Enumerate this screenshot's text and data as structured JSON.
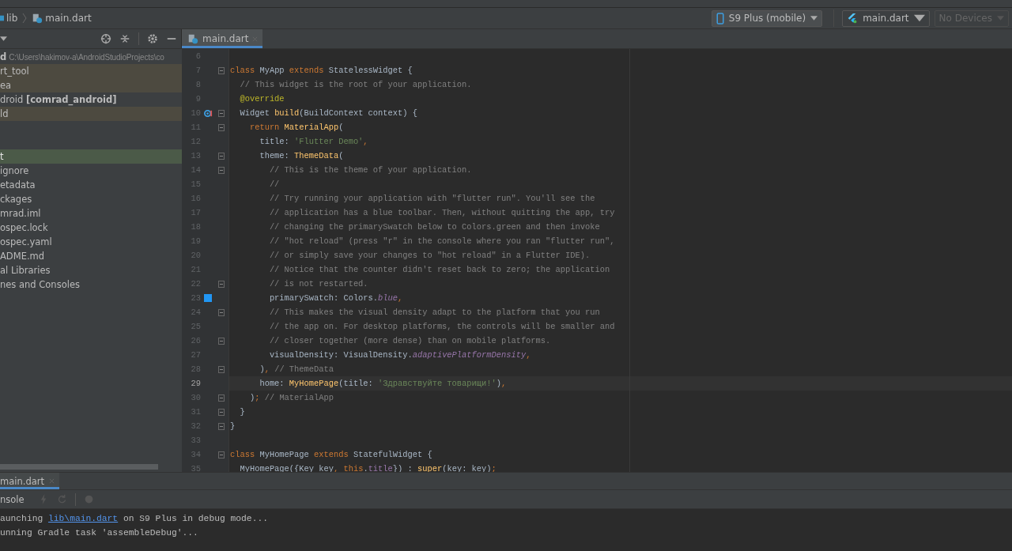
{
  "breadcrumbs": [
    {
      "label": "lib",
      "kind": "folder"
    },
    {
      "label": "main.dart",
      "kind": "dart"
    }
  ],
  "run_controls": [
    {
      "label": "S9 Plus (mobile)",
      "kind": "device",
      "disabled": false
    },
    {
      "label": "main.dart",
      "kind": "config",
      "disabled": false
    },
    {
      "label": "No Devices",
      "kind": "plain",
      "disabled": true
    }
  ],
  "editor_tabs": [
    {
      "label": "main.dart",
      "selected": true
    }
  ],
  "project_tree": [
    {
      "label": "d",
      "path": "C:\\Users\\hakimov-a\\AndroidStudioProjects\\co",
      "kind": "root",
      "selected": false
    },
    {
      "label": "rt_tool",
      "kind": "excluded",
      "selected": false
    },
    {
      "label": "ea",
      "kind": "excluded",
      "selected": false
    },
    {
      "label": "droid **[comrad_android]**",
      "kind": "plain",
      "selected": false
    },
    {
      "label": "ld",
      "kind": "excluded",
      "selected": false
    },
    {
      "kind": "plain",
      "selected": false
    },
    {
      "kind": "plain",
      "selected": false
    },
    {
      "label": "t",
      "kind": "plain",
      "selected": true
    },
    {
      "label": "ignore",
      "kind": "plain",
      "selected": false
    },
    {
      "label": "etadata",
      "kind": "plain",
      "selected": false
    },
    {
      "label": "ckages",
      "kind": "plain",
      "selected": false
    },
    {
      "label": "mrad.iml",
      "kind": "plain",
      "selected": false
    },
    {
      "label": "ospec.lock",
      "kind": "plain",
      "selected": false
    },
    {
      "label": "ospec.yaml",
      "kind": "plain",
      "selected": false
    },
    {
      "label": "ADME.md",
      "kind": "plain",
      "selected": false
    },
    {
      "label": "al Libraries",
      "kind": "plain",
      "selected": false
    },
    {
      "label": "nes and Consoles",
      "kind": "plain",
      "selected": false
    }
  ],
  "code_lines": [
    {
      "number": "6"
    },
    {
      "number": "7",
      "fold": true,
      "tokens": [
        {
          "kind": "keyword",
          "text": "class "
        },
        {
          "kind": "plain",
          "text": "MyApp "
        },
        {
          "kind": "keyword",
          "text": "extends "
        },
        {
          "kind": "plain",
          "text": "StatelessWidget {"
        }
      ]
    },
    {
      "number": "8",
      "tokens": [
        {
          "kind": "comment",
          "text": "  // This widget is the root of your application."
        }
      ]
    },
    {
      "number": "9",
      "tokens": [
        {
          "kind": "annotation",
          "text": "  @override"
        }
      ]
    },
    {
      "number": "10",
      "fold": true,
      "overrides": true,
      "tokens": [
        {
          "kind": "plain",
          "text": "  Widget "
        },
        {
          "kind": "function",
          "text": "build"
        },
        {
          "kind": "plain",
          "text": "(BuildContext context) {"
        }
      ]
    },
    {
      "number": "11",
      "fold": true,
      "tokens": [
        {
          "kind": "keyword",
          "text": "    return "
        },
        {
          "kind": "function",
          "text": "MaterialApp"
        },
        {
          "kind": "plain",
          "text": "("
        }
      ]
    },
    {
      "number": "12",
      "tokens": [
        {
          "kind": "plain",
          "text": "      title: "
        },
        {
          "kind": "string",
          "text": "'Flutter Demo'"
        },
        {
          "kind": "keyword",
          "text": ","
        }
      ]
    },
    {
      "number": "13",
      "fold": true,
      "tokens": [
        {
          "kind": "plain",
          "text": "      theme: "
        },
        {
          "kind": "function",
          "text": "ThemeData"
        },
        {
          "kind": "plain",
          "text": "("
        }
      ]
    },
    {
      "number": "14",
      "fold": true,
      "tokens": [
        {
          "kind": "comment",
          "text": "        // This is the theme of your application."
        }
      ]
    },
    {
      "number": "15",
      "tokens": [
        {
          "kind": "comment",
          "text": "        //"
        }
      ]
    },
    {
      "number": "16",
      "tokens": [
        {
          "kind": "comment",
          "text": "        // Try running your application with \"flutter run\". You'll see the"
        }
      ]
    },
    {
      "number": "17",
      "tokens": [
        {
          "kind": "comment",
          "text": "        // application has a blue toolbar. Then, without quitting the app, try"
        }
      ]
    },
    {
      "number": "18",
      "tokens": [
        {
          "kind": "comment",
          "text": "        // changing the primarySwatch below to Colors.green and then invoke"
        }
      ]
    },
    {
      "number": "19",
      "tokens": [
        {
          "kind": "comment",
          "text": "        // \"hot reload\" (press \"r\" in the console where you ran \"flutter run\","
        }
      ]
    },
    {
      "number": "20",
      "tokens": [
        {
          "kind": "comment",
          "text": "        // or simply save your changes to \"hot reload\" in a Flutter IDE)."
        }
      ]
    },
    {
      "number": "21",
      "tokens": [
        {
          "kind": "comment",
          "text": "        // Notice that the counter didn't reset back to zero; the application"
        }
      ]
    },
    {
      "number": "22",
      "fold": true,
      "tokens": [
        {
          "kind": "comment",
          "text": "        // is not restarted."
        }
      ]
    },
    {
      "number": "23",
      "color": "#2196f3",
      "tokens": [
        {
          "kind": "plain",
          "text": "        primarySwatch: Colors."
        },
        {
          "kind": "static",
          "text": "blue"
        },
        {
          "kind": "keyword",
          "text": ","
        }
      ]
    },
    {
      "number": "24",
      "fold": true,
      "tokens": [
        {
          "kind": "comment",
          "text": "        // This makes the visual density adapt to the platform that you run"
        }
      ]
    },
    {
      "number": "25",
      "tokens": [
        {
          "kind": "comment",
          "text": "        // the app on. For desktop platforms, the controls will be smaller and"
        }
      ]
    },
    {
      "number": "26",
      "fold": true,
      "tokens": [
        {
          "kind": "comment",
          "text": "        // closer together (more dense) than on mobile platforms."
        }
      ]
    },
    {
      "number": "27",
      "tokens": [
        {
          "kind": "plain",
          "text": "        visualDensity: VisualDensity."
        },
        {
          "kind": "static",
          "text": "adaptivePlatformDensity"
        },
        {
          "kind": "keyword",
          "text": ","
        }
      ]
    },
    {
      "number": "28",
      "fold": true,
      "tokens": [
        {
          "kind": "plain",
          "text": "      )"
        },
        {
          "kind": "keyword",
          "text": ", "
        },
        {
          "kind": "comment",
          "text": "// ThemeData"
        }
      ]
    },
    {
      "number": "29",
      "current": true,
      "tokens": [
        {
          "kind": "plain",
          "text": "      home: "
        },
        {
          "kind": "function",
          "text": "MyHomePage"
        },
        {
          "kind": "plain",
          "text": "(title: "
        },
        {
          "kind": "string",
          "text": "'Здравствуйте товарищи!'"
        },
        {
          "kind": "plain",
          "text": ")"
        },
        {
          "kind": "keyword",
          "text": ","
        }
      ]
    },
    {
      "number": "30",
      "fold": true,
      "tokens": [
        {
          "kind": "plain",
          "text": "    )"
        },
        {
          "kind": "keyword",
          "text": "; "
        },
        {
          "kind": "comment",
          "text": "// MaterialApp"
        }
      ]
    },
    {
      "number": "31",
      "fold": true,
      "tokens": [
        {
          "kind": "plain",
          "text": "  }"
        }
      ]
    },
    {
      "number": "32",
      "fold": true,
      "tokens": [
        {
          "kind": "plain",
          "text": "}"
        }
      ]
    },
    {
      "number": "33"
    },
    {
      "number": "34",
      "fold": true,
      "tokens": [
        {
          "kind": "keyword",
          "text": "class "
        },
        {
          "kind": "plain",
          "text": "MyHomePage "
        },
        {
          "kind": "keyword",
          "text": "extends "
        },
        {
          "kind": "plain",
          "text": "StatefulWidget {"
        }
      ]
    },
    {
      "number": "35",
      "tokens": [
        {
          "kind": "plain",
          "text": "  MyHomePage({Key key"
        },
        {
          "kind": "keyword",
          "text": ", this"
        },
        {
          "kind": "plain",
          "text": "."
        },
        {
          "kind": "field",
          "text": "title"
        },
        {
          "kind": "plain",
          "text": "}) : "
        },
        {
          "kind": "function",
          "text": "super"
        },
        {
          "kind": "plain",
          "text": "(key: key)"
        },
        {
          "kind": "keyword",
          "text": ";"
        }
      ]
    }
  ],
  "run_tabs": [
    {
      "label": "main.dart",
      "selected": true
    }
  ],
  "console_toolbar": {
    "label": "nsole"
  },
  "console_lines": [
    {
      "parts": [
        {
          "kind": "text",
          "text": "aunching "
        },
        {
          "kind": "link",
          "text": "lib\\main.dart"
        },
        {
          "kind": "text",
          "text": " on S9 Plus in debug mode..."
        }
      ]
    },
    {
      "parts": [
        {
          "kind": "text",
          "text": "unning Gradle task 'assembleDebug'..."
        }
      ]
    }
  ]
}
